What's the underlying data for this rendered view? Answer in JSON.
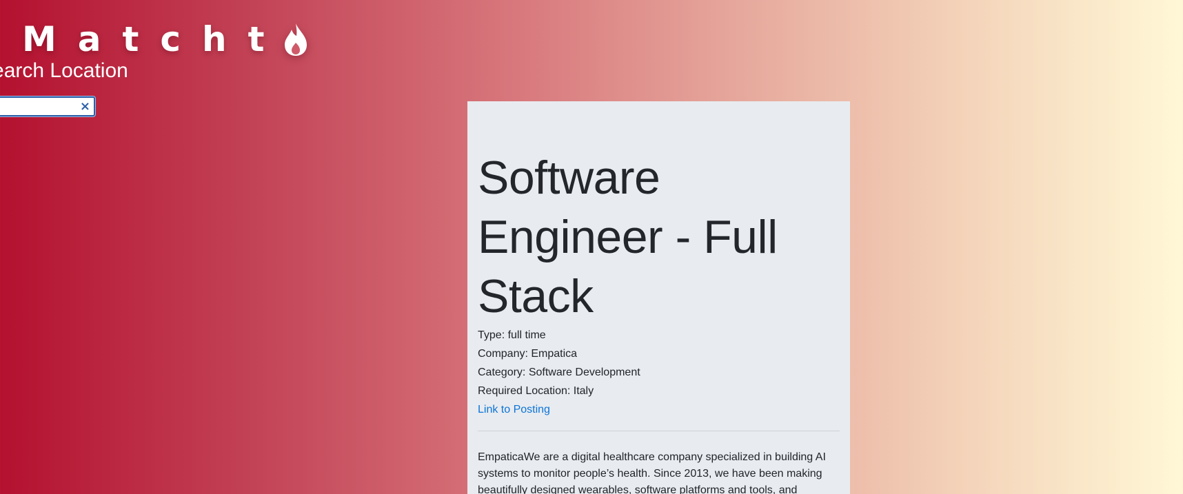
{
  "logo": {
    "text": "Matcht",
    "icon": "flame-icon"
  },
  "search": {
    "label": "Search Location",
    "value": "",
    "placeholder": "",
    "clear_icon": "close-icon"
  },
  "job": {
    "title": "Software Engineer - Full Stack",
    "type": "Type: full time",
    "company": "Company: Empatica",
    "category": "Category: Software Development",
    "location": "Required Location: Italy",
    "link_label": "Link to Posting",
    "description": "EmpaticaWe are a digital healthcare company specialized in building AI systems to monitor people’s health. Since 2013, we have been making beautifully designed wearables, software platforms and tools, and"
  },
  "colors": {
    "gradient_start": "#b4112f",
    "gradient_end": "#fff8d6",
    "card_bg": "#e8ebef",
    "link": "#0b74d9"
  }
}
